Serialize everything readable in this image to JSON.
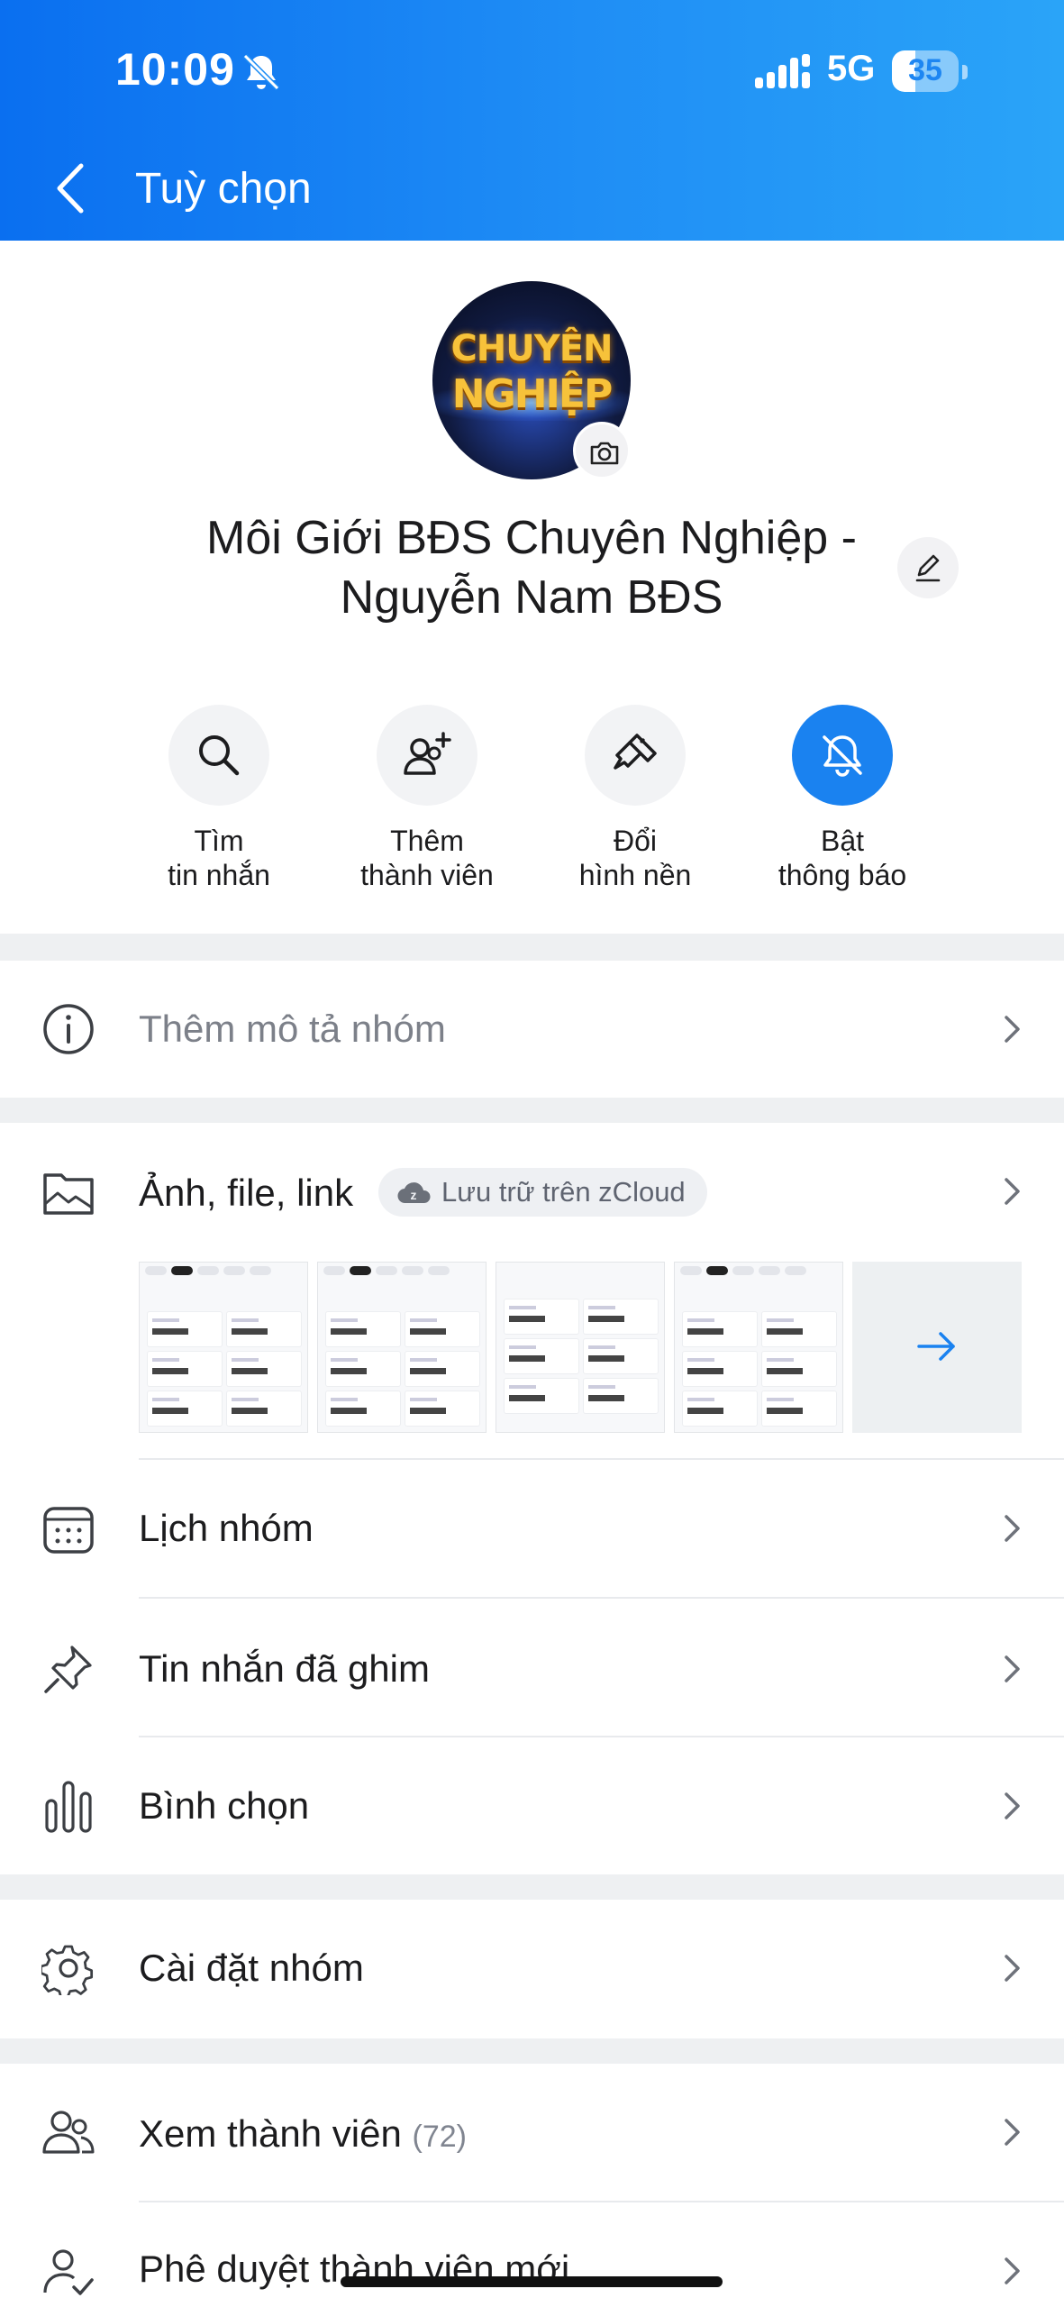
{
  "status_bar": {
    "time": "10:09",
    "network": "5G",
    "battery": "35",
    "battery_level": 0.35
  },
  "header": {
    "title": "Tuỳ chọn"
  },
  "profile": {
    "avatar_text_line1": "CHUYÊN",
    "avatar_text_line2": "NGHIỆP",
    "group_name": "Môi Giới BĐS Chuyên Nghiệp - Nguyễn Nam BĐS"
  },
  "quick_actions": [
    {
      "label": "Tìm\ntin nhắn",
      "icon": "search-icon"
    },
    {
      "label": "Thêm\nthành viên",
      "icon": "add-member-icon"
    },
    {
      "label": "Đổi\nhình nền",
      "icon": "paint-brush-icon"
    },
    {
      "label": "Bật\nthông báo",
      "icon": "bell-off-icon"
    }
  ],
  "description": {
    "label": "Thêm mô tả nhóm"
  },
  "media": {
    "label": "Ảnh, file, link",
    "zcloud_label": "Lưu trữ trên zCloud"
  },
  "menu": {
    "calendar": "Lịch nhóm",
    "pinned": "Tin nhắn đã ghim",
    "poll": "Bình chọn",
    "settings": "Cài đặt nhóm",
    "members": "Xem thành viên",
    "members_count": "(72)",
    "approve": "Phê duyệt thành viên mới"
  },
  "colors": {
    "header_start": "#0a6ff0",
    "header_end": "#2aa4f8",
    "accent": "#1a82f0"
  }
}
